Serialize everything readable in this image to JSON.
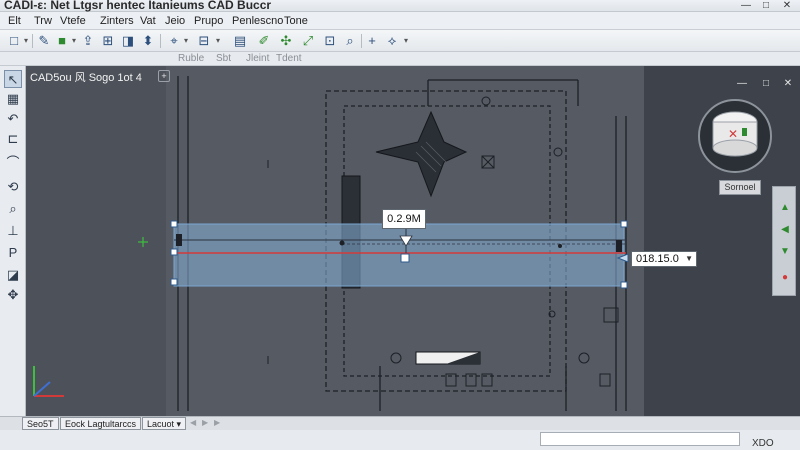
{
  "window": {
    "title": "CADI-ε: Net Ltgsr hentec Itanieums CAD Buccr",
    "controls": {
      "minimize": "—",
      "maximize": "□",
      "close": "✕"
    }
  },
  "menu": [
    "Elt",
    "Trw",
    "Vtefe",
    "Zinters",
    "Vat",
    "Jeio",
    "Prupo",
    "Penlescno",
    "Tone"
  ],
  "ribbon_tabs": [
    "Ruble",
    "Sbt",
    "Jleint",
    "Tdent"
  ],
  "viewport": {
    "title": "CAD5ou 风 Sogo 1ot 4",
    "menu_button": "+",
    "controls": {
      "minimize": "—",
      "restore": "□",
      "close": "✕"
    },
    "viewcube_label": "Sornoel"
  },
  "dimension": {
    "label": "0.2.9M",
    "length_value": "018.15.0"
  },
  "layout_tabs": [
    "Seo5T",
    "Eock Lagtultarccs",
    "Lacuot"
  ],
  "layout_tab_menu": "▾",
  "status": {
    "right_text": "XDO"
  },
  "colors": {
    "viewport_bg": "#555a63",
    "selection": "#8ab4dc",
    "red_line": "#d23a3a",
    "accent": "#2e8a2e"
  },
  "icons": {
    "toolbar": [
      "new-file-icon",
      "save-icon",
      "open-icon",
      "properties-icon",
      "layers-icon",
      "undo-icon",
      "redo-icon",
      "line-icon",
      "match-icon",
      "copy-icon",
      "highlight-icon",
      "zoom-icon",
      "move-icon",
      "crosshair-icon"
    ],
    "left_tools": [
      "select-arrow-icon",
      "layers-icon",
      "undo-icon",
      "polyline-icon",
      "arc-icon",
      "rotate-icon",
      "zoom-icon",
      "snap-icon",
      "text-icon",
      "grip-icon",
      "pan-icon"
    ]
  }
}
